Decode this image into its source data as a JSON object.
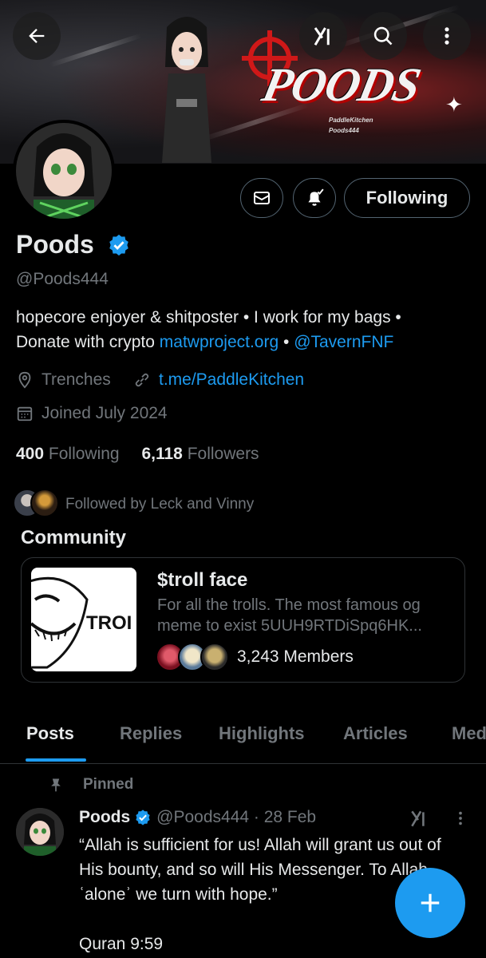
{
  "banner": {
    "title": "POODS",
    "sub1": "PaddleKitchen",
    "sub2": "Poods444"
  },
  "header_actions": [
    "back-icon",
    "grok-icon",
    "search-icon",
    "more-vertical-icon"
  ],
  "profile": {
    "name": "Poods",
    "handle": "@Poods444",
    "bio_text1": "hopecore enjoyer & shitposter • I work for my bags •",
    "bio_text2": "Donate with crypto ",
    "bio_link1": "matwproject.org",
    "bio_sep": " • ",
    "bio_link2": "@TavernFNF",
    "location": "Trenches",
    "website": "t.me/PaddleKitchen",
    "joined": "Joined July 2024",
    "following_count": "400",
    "following_label": "Following",
    "followers_count": "6,118",
    "followers_label": "Followers",
    "followed_by": "Followed by Leck and Vinny"
  },
  "buttons": {
    "following": "Following"
  },
  "community": {
    "heading": "Community",
    "name": "$troll face",
    "description": "For all the trolls. The most famous og meme to exist 5UUH9RTDiSpq6HK...",
    "thumb_text": "TROI",
    "members": "3,243 Members"
  },
  "tabs": [
    "Posts",
    "Replies",
    "Highlights",
    "Articles",
    "Med"
  ],
  "post": {
    "pinned_label": "Pinned",
    "name": "Poods",
    "handle_date": "@Poods444 · 28 Feb",
    "text": "“Allah is sufficient for us! Allah will grant us out of His bounty, and so will His Messenger. To Allah ʿaloneʾ we turn with hope.”\n\nQuran 9:59"
  },
  "colors": {
    "accent": "#1d9bf0",
    "background": "#000000",
    "text": "#e7e9ea",
    "muted": "#71767b",
    "border": "#2f3336"
  }
}
